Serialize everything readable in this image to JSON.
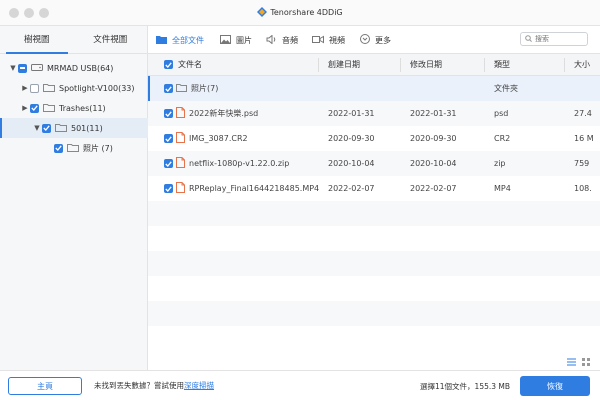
{
  "app": {
    "title": "Tenorshare 4DDiG"
  },
  "sidebar": {
    "tabs": [
      {
        "label": "樹視圖",
        "active": true
      },
      {
        "label": "文件視圖",
        "active": false
      }
    ],
    "tree": [
      {
        "label": "MRMAD USB(64)",
        "expand": "▼",
        "check": "partial",
        "icon": "drive-icon"
      },
      {
        "label": "Spotlight-V100(33)",
        "expand": "▶",
        "check": "none",
        "icon": "folder-icon"
      },
      {
        "label": "Trashes(11)",
        "expand": "▶",
        "check": "checked",
        "icon": "folder-icon"
      },
      {
        "label": "501(11)",
        "expand": "▼",
        "check": "checked",
        "icon": "folder-icon",
        "selected": true
      },
      {
        "label": "照片 (7)",
        "expand": "",
        "check": "checked",
        "icon": "folder-icon"
      }
    ]
  },
  "toolbar": {
    "all_files": "全部文件",
    "images": "圖片",
    "audio": "音頻",
    "video": "視頻",
    "more": "更多",
    "search_placeholder": "搜索"
  },
  "table": {
    "headers": {
      "name": "文件名",
      "created": "創建日期",
      "modified": "修改日期",
      "type": "類型",
      "size": "大小"
    },
    "rows": [
      {
        "name": "照片(7)",
        "created": "",
        "modified": "",
        "type": "文件夾",
        "size": "",
        "kind": "folder"
      },
      {
        "name": "2022新年快樂.psd",
        "created": "2022-01-31",
        "modified": "2022-01-31",
        "type": "psd",
        "size": "27.4",
        "kind": "file"
      },
      {
        "name": "IMG_3087.CR2",
        "created": "2020-09-30",
        "modified": "2020-09-30",
        "type": "CR2",
        "size": "16 M",
        "kind": "file"
      },
      {
        "name": "netflix-1080p-v1.22.0.zip",
        "created": "2020-10-04",
        "modified": "2020-10-04",
        "type": "zip",
        "size": "759",
        "kind": "file"
      },
      {
        "name": "RPReplay_Final1644218485.MP4",
        "created": "2022-02-07",
        "modified": "2022-02-07",
        "type": "MP4",
        "size": "108.",
        "kind": "file"
      }
    ]
  },
  "footer": {
    "home_button": "主頁",
    "hint_text": "未找到丟失數據？嘗試使用",
    "hint_link": "深度掃描",
    "selection_info": "選擇11個文件，155.3 MB",
    "recover_button": "恢復"
  },
  "colors": {
    "accent": "#2f7de1",
    "file_icon": "#e8734a"
  }
}
